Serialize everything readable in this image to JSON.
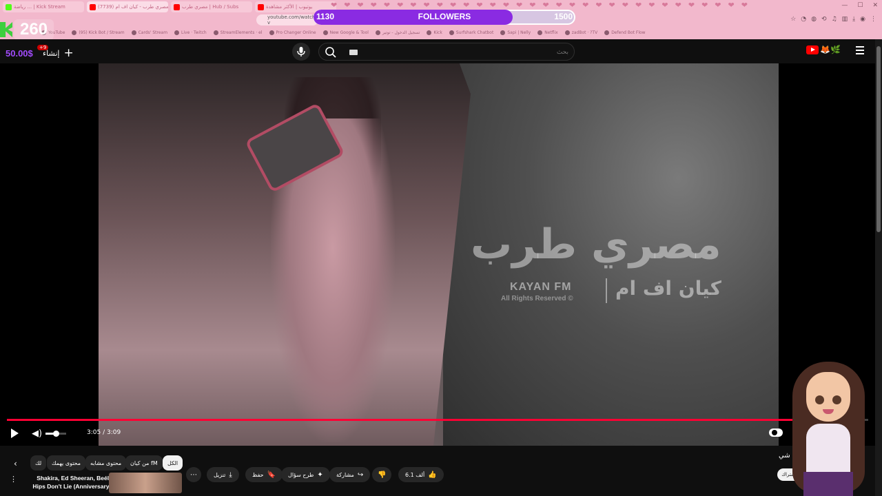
{
  "browser": {
    "tabs": [
      {
        "label": "رياضة ... | Kick Stream",
        "color": "#53fc18"
      },
      {
        "label": "(7739) مصري طرب - كيان اف ام",
        "color": "#ff0000"
      },
      {
        "label": "مصري طرب | Hub / Subs",
        "color": "#ff0000"
      },
      {
        "label": "يوتيوب | الأكثر مشاهدة",
        "color": "#ff0000"
      }
    ],
    "url": "youtube.com/watch?v",
    "window_controls": [
      "—",
      "☐",
      "✕"
    ],
    "bookmarks": [
      "YouTube",
      "(95) Kick Bot / Stream",
      "Cards' Stream",
      "Live · Twitch",
      "StreamElements · el",
      "Pro Changer Online",
      "New Google & Tool",
      "تسجيل الدخول - توتير",
      "Kick",
      "Surfshark Chatbot",
      "Sapi | Nelly",
      "Netflix",
      "zadBot · ?TV",
      "Defend Bot Flow"
    ]
  },
  "overlay": {
    "followers_current": "1130",
    "followers_label": "FOLLOWERS",
    "followers_goal": "1500",
    "followers_progress": 0.76,
    "viewer_count": "260",
    "money": "50.00$"
  },
  "header": {
    "create_label": "إنشاء",
    "notification_count": "+9",
    "search_placeholder": "بحث"
  },
  "video": {
    "watermark_arabic": "مصري طرب",
    "watermark_english": "KAYAN FM",
    "watermark_arabic_brand": "كيان اف ام",
    "watermark_rights": "All Rights Reserved ©",
    "current_time": "3:05",
    "duration": "3:09",
    "time_display": "3:05 / 3:09",
    "progress": 0.979,
    "volume": 0.5
  },
  "chips": [
    {
      "label": "الكل",
      "active": true
    },
    {
      "label": "من كيان fM",
      "active": false
    },
    {
      "label": "محتوى مشابه",
      "active": false
    },
    {
      "label": "محتوى يهمك",
      "active": false
    },
    {
      "label": "لك",
      "active": false
    }
  ],
  "actions": [
    {
      "label": "",
      "icon": "⋯"
    },
    {
      "label": "تنزيل",
      "icon": "⤓"
    },
    {
      "label": "حفظ",
      "icon": "🔖"
    },
    {
      "label": "طرح سؤال",
      "icon": "✦"
    },
    {
      "label": "مشاركة",
      "icon": "↪"
    },
    {
      "label": "",
      "icon": "👎"
    },
    {
      "label": "6.1 ألف",
      "icon": "👍"
    }
  ],
  "up_next": {
    "title": "Shakira, Ed Sheeran, Beéle - Hips Don't Lie (Anniversary ..."
  },
  "channel": {
    "name": "شي",
    "subscribe_label": "اشتراك"
  },
  "colors": {
    "chrome": "#f2b8cc",
    "youtube_red": "#ff0033",
    "followers_fill": "#8a2be2",
    "money": "#a34cff",
    "kick_green": "#53fc18"
  }
}
